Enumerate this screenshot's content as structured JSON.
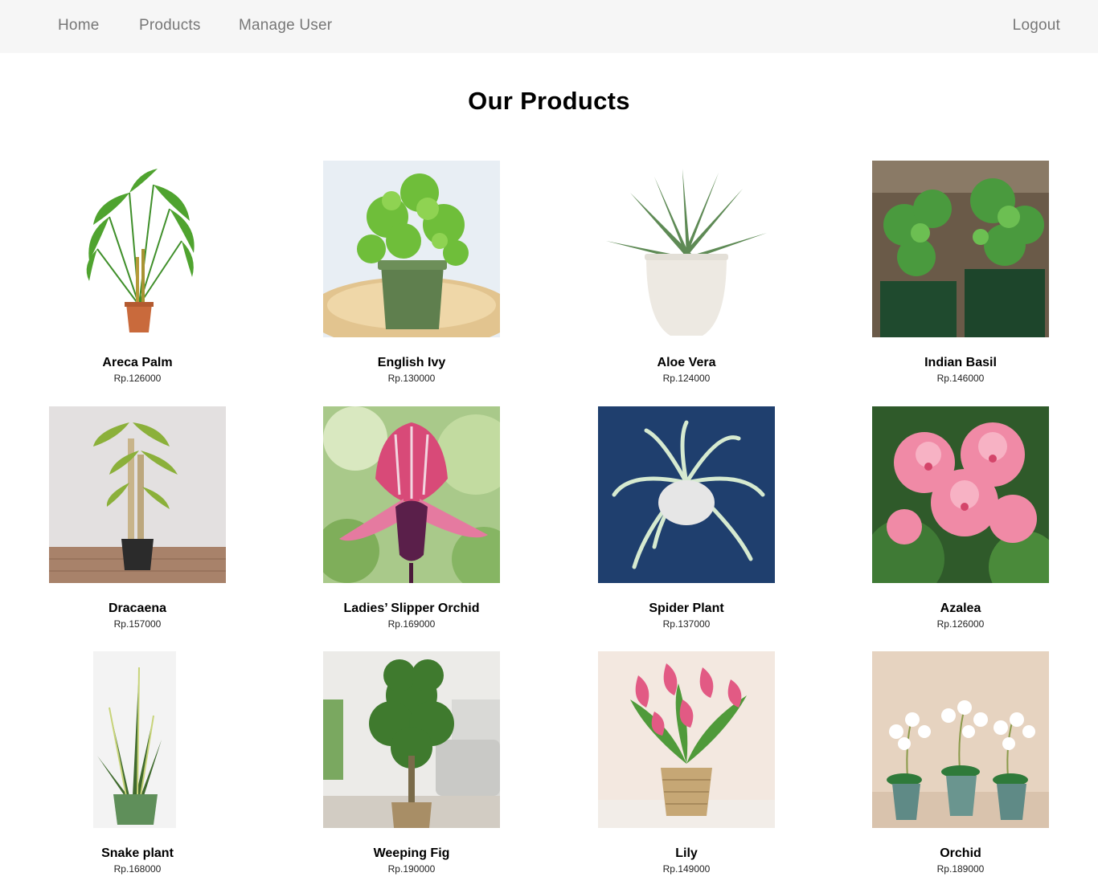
{
  "nav": {
    "home": "Home",
    "products": "Products",
    "manage_user": "Manage User",
    "logout": "Logout"
  },
  "page_title": "Our Products",
  "products": [
    {
      "name": "Areca Palm",
      "price": "Rp.126000",
      "image": "areca-palm-image"
    },
    {
      "name": "English Ivy",
      "price": "Rp.130000",
      "image": "english-ivy-image"
    },
    {
      "name": "Aloe Vera",
      "price": "Rp.124000",
      "image": "aloe-vera-image"
    },
    {
      "name": "Indian Basil",
      "price": "Rp.146000",
      "image": "indian-basil-image"
    },
    {
      "name": "Dracaena",
      "price": "Rp.157000",
      "image": "dracaena-image"
    },
    {
      "name": "Ladies’ Slipper Orchid",
      "price": "Rp.169000",
      "image": "ladies-slipper-orchid-image"
    },
    {
      "name": "Spider Plant",
      "price": "Rp.137000",
      "image": "spider-plant-image"
    },
    {
      "name": "Azalea",
      "price": "Rp.126000",
      "image": "azalea-image"
    },
    {
      "name": "Snake plant",
      "price": "Rp.168000",
      "image": "snake-plant-image"
    },
    {
      "name": "Weeping Fig",
      "price": "Rp.190000",
      "image": "weeping-fig-image"
    },
    {
      "name": "Lily",
      "price": "Rp.149000",
      "image": "lily-image"
    },
    {
      "name": "Orchid",
      "price": "Rp.189000",
      "image": "orchid-image"
    }
  ],
  "colors": {
    "navbar_bg": "#f6f6f6",
    "nav_text": "#777777",
    "title_text": "#000000"
  }
}
